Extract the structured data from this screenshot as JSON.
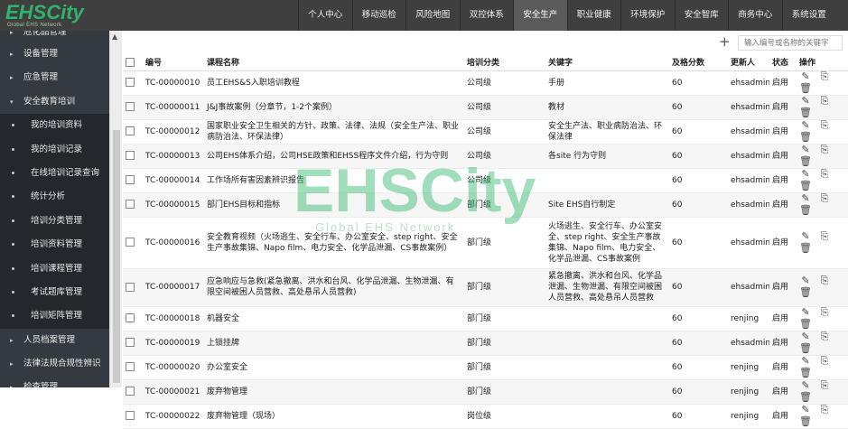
{
  "logo": {
    "main": "EHSCity",
    "sub": "Global EHS Network"
  },
  "nav": {
    "items": [
      "个人中心",
      "移动巡检",
      "风险地图",
      "双控体系",
      "安全生产",
      "职业健康",
      "环境保护",
      "安全智库",
      "商务中心",
      "系统设置"
    ],
    "active_index": 4
  },
  "sidebar": {
    "items": [
      {
        "label": "危化品管理",
        "type": "group",
        "arrow": "▸"
      },
      {
        "label": "设备管理",
        "type": "group",
        "arrow": "▸"
      },
      {
        "label": "应急管理",
        "type": "group",
        "arrow": "▸"
      },
      {
        "label": "安全教育培训",
        "type": "group",
        "arrow": "▾"
      },
      {
        "label": "我的培训资料",
        "type": "sub"
      },
      {
        "label": "我的培训记录",
        "type": "sub"
      },
      {
        "label": "在线培训记录查询",
        "type": "sub"
      },
      {
        "label": "统计分析",
        "type": "sub"
      },
      {
        "label": "培训分类管理",
        "type": "sub"
      },
      {
        "label": "培训资料管理",
        "type": "sub"
      },
      {
        "label": "培训课程管理",
        "type": "sub"
      },
      {
        "label": "考试题库管理",
        "type": "sub"
      },
      {
        "label": "培训矩阵管理",
        "type": "sub"
      },
      {
        "label": "人员档案管理",
        "type": "group",
        "arrow": "▸"
      },
      {
        "label": "法律法规合规性辨识",
        "type": "group",
        "arrow": "▸"
      },
      {
        "label": "检查管理",
        "type": "group",
        "arrow": "▸"
      }
    ]
  },
  "toolbar": {
    "search_placeholder": "输入编号或名称的关键字"
  },
  "table": {
    "headers": [
      "编号",
      "课程名称",
      "培训分类",
      "关键字",
      "及格分数",
      "更新人",
      "状态",
      "操作"
    ],
    "rows": [
      {
        "code": "TC-00000010",
        "name": "员工EHS&S入职培训教程",
        "category": "公司级",
        "keyword": "手册",
        "pass": "60",
        "updater": "ehsadmin",
        "status": "启用"
      },
      {
        "code": "TC-00000011",
        "name": "J&J事故案例（分章节，1-2个案例）",
        "category": "公司级",
        "keyword": "教材",
        "pass": "60",
        "updater": "ehsadmin",
        "status": "启用"
      },
      {
        "code": "TC-00000012",
        "name": "国家职业安全卫生相关的方针、政策、法律、法规（安全生产法、职业病防治法、环保法律）",
        "category": "公司级",
        "keyword": "安全生产法、职业病防治法、环保法律",
        "pass": "60",
        "updater": "ehsadmin",
        "status": "启用"
      },
      {
        "code": "TC-00000013",
        "name": "公司EHS体系介绍，公司HSE政策和EHSS程序文件介绍，行为守则",
        "category": "公司级",
        "keyword": "各site 行为守则",
        "pass": "60",
        "updater": "ehsadmin",
        "status": "启用"
      },
      {
        "code": "TC-00000014",
        "name": "工作场所有害因素辨识报告",
        "category": "公司级",
        "keyword": "",
        "pass": "60",
        "updater": "ehsadmin",
        "status": "启用"
      },
      {
        "code": "TC-00000015",
        "name": "部门EHS目标和指标",
        "category": "部门级",
        "keyword": "Site EHS自行制定",
        "pass": "60",
        "updater": "ehsadmin",
        "status": "启用"
      },
      {
        "code": "TC-00000016",
        "name": "安全教育视频（火场逃生、安全行车、办公室安全、step right、安全生产事故集锦、Napo film、电力安全、化学品泄漏、CS事故案例）",
        "category": "部门级",
        "keyword": "火场逃生、安全行车、办公室安全、step right、安全生产事故集锦、Napo film、电力安全、化学品泄漏、CS事故案例",
        "pass": "60",
        "updater": "ehsadmin",
        "status": "启用"
      },
      {
        "code": "TC-00000017",
        "name": "应急响应与急救(紧急撤离、洪水和台风、化学品泄漏、生物泄漏、有限空间被困人员营救、高处悬吊人员营救)",
        "category": "部门级",
        "keyword": "紧急撤离、洪水和台风、化学品泄漏、生物泄漏、有限空间被困人员营救、高处悬吊人员营救",
        "pass": "60",
        "updater": "ehsadmin",
        "status": "启用"
      },
      {
        "code": "TC-00000018",
        "name": "机器安全",
        "category": "部门级",
        "keyword": "",
        "pass": "60",
        "updater": "renjing",
        "status": "启用"
      },
      {
        "code": "TC-00000019",
        "name": "上锁挂牌",
        "category": "部门级",
        "keyword": "",
        "pass": "60",
        "updater": "ehsadmin",
        "status": "启用"
      },
      {
        "code": "TC-00000020",
        "name": "办公室安全",
        "category": "部门级",
        "keyword": "",
        "pass": "60",
        "updater": "renjing",
        "status": "启用"
      },
      {
        "code": "TC-00000021",
        "name": "废弃物管理",
        "category": "部门级",
        "keyword": "",
        "pass": "60",
        "updater": "renjing",
        "status": "启用"
      },
      {
        "code": "TC-00000022",
        "name": "废弃物管理（现场）",
        "category": "岗位级",
        "keyword": "",
        "pass": "60",
        "updater": "renjing",
        "status": "启用"
      }
    ],
    "row_heights": []
  },
  "icons": {
    "edit": "edit-icon",
    "export": "export-icon",
    "delete": "trash-icon",
    "plus": "plus-icon"
  },
  "watermark": {
    "main": "EHSCity",
    "sub": "Global EHS Network"
  },
  "colors": {
    "brand": "#2fb56b",
    "topbar": "#3f3f3f",
    "sidebar": "#2d3238"
  }
}
